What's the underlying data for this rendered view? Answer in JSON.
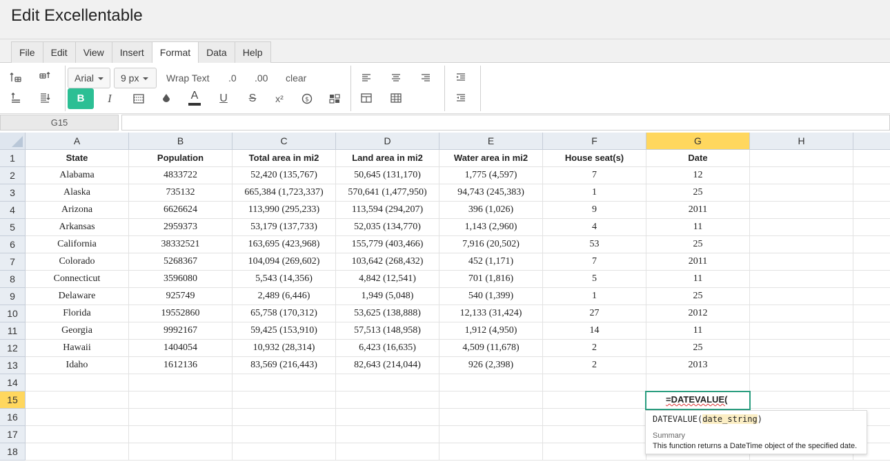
{
  "window": {
    "title": "Edit Excellentable"
  },
  "menu": [
    "File",
    "Edit",
    "View",
    "Insert",
    "Format",
    "Data",
    "Help"
  ],
  "menu_active": "Format",
  "toolbar": {
    "font_family": "Arial",
    "font_size": "9 px",
    "wrap_text": "Wrap Text",
    "decimal_one": ".0",
    "decimal_two": ".00",
    "clear": "clear",
    "bold": "B",
    "italic": "I",
    "underline": "U",
    "strike": "S",
    "superscript": "x²",
    "accent_color": "#2cbf94"
  },
  "name_box": "G15",
  "formula_value": "",
  "columns": [
    "A",
    "B",
    "C",
    "D",
    "E",
    "F",
    "G",
    "H"
  ],
  "selected_column": "G",
  "selected_row": "15",
  "rows": [
    {
      "num": "1",
      "cells": [
        "State",
        "Population",
        "Total area in mi2",
        "Land area in mi2",
        "Water area in mi2",
        "House seat(s)",
        "Date",
        ""
      ]
    },
    {
      "num": "2",
      "cells": [
        "Alabama",
        "4833722",
        "52,420 (135,767)",
        "50,645 (131,170)",
        "1,775 (4,597)",
        "7",
        "12",
        ""
      ]
    },
    {
      "num": "3",
      "cells": [
        "Alaska",
        "735132",
        "665,384 (1,723,337)",
        "570,641 (1,477,950)",
        "94,743 (245,383)",
        "1",
        "25",
        ""
      ]
    },
    {
      "num": "4",
      "cells": [
        "Arizona",
        "6626624",
        "113,990 (295,233)",
        "113,594 (294,207)",
        "396 (1,026)",
        "9",
        "2011",
        ""
      ]
    },
    {
      "num": "5",
      "cells": [
        "Arkansas",
        "2959373",
        "53,179 (137,733)",
        "52,035 (134,770)",
        "1,143 (2,960)",
        "4",
        "11",
        ""
      ]
    },
    {
      "num": "6",
      "cells": [
        "California",
        "38332521",
        "163,695 (423,968)",
        "155,779 (403,466)",
        "7,916 (20,502)",
        "53",
        "25",
        ""
      ]
    },
    {
      "num": "7",
      "cells": [
        "Colorado",
        "5268367",
        "104,094 (269,602)",
        "103,642 (268,432)",
        "452 (1,171)",
        "7",
        "2011",
        ""
      ]
    },
    {
      "num": "8",
      "cells": [
        "Connecticut",
        "3596080",
        "5,543 (14,356)",
        "4,842 (12,541)",
        "701 (1,816)",
        "5",
        "11",
        ""
      ]
    },
    {
      "num": "9",
      "cells": [
        "Delaware",
        "925749",
        "2,489 (6,446)",
        "1,949 (5,048)",
        "540 (1,399)",
        "1",
        "25",
        ""
      ]
    },
    {
      "num": "10",
      "cells": [
        "Florida",
        "19552860",
        "65,758 (170,312)",
        "53,625 (138,888)",
        "12,133 (31,424)",
        "27",
        "2012",
        ""
      ]
    },
    {
      "num": "11",
      "cells": [
        "Georgia",
        "9992167",
        "59,425 (153,910)",
        "57,513 (148,958)",
        "1,912 (4,950)",
        "14",
        "11",
        ""
      ]
    },
    {
      "num": "12",
      "cells": [
        "Hawaii",
        "1404054",
        "10,932 (28,314)",
        "6,423 (16,635)",
        "4,509 (11,678)",
        "2",
        "25",
        ""
      ]
    },
    {
      "num": "13",
      "cells": [
        "Idaho",
        "1612136",
        "83,569 (216,443)",
        "82,643 (214,044)",
        "926 (2,398)",
        "2",
        "2013",
        ""
      ]
    },
    {
      "num": "14",
      "cells": [
        "",
        "",
        "",
        "",
        "",
        "",
        "",
        ""
      ]
    },
    {
      "num": "15",
      "cells": [
        "",
        "",
        "",
        "",
        "",
        "",
        "",
        ""
      ]
    },
    {
      "num": "16",
      "cells": [
        "",
        "",
        "",
        "",
        "",
        "",
        "",
        ""
      ]
    },
    {
      "num": "17",
      "cells": [
        "",
        "",
        "",
        "",
        "",
        "",
        "",
        ""
      ]
    },
    {
      "num": "18",
      "cells": [
        "",
        "",
        "",
        "",
        "",
        "",
        "",
        ""
      ]
    }
  ],
  "editor": {
    "text": "=DATEVALUE("
  },
  "tooltip": {
    "fn": "DATEVALUE(",
    "arg": "date_string",
    "close": ")",
    "summary_label": "Summary",
    "summary": "This function returns a DateTime object of the specified date."
  }
}
